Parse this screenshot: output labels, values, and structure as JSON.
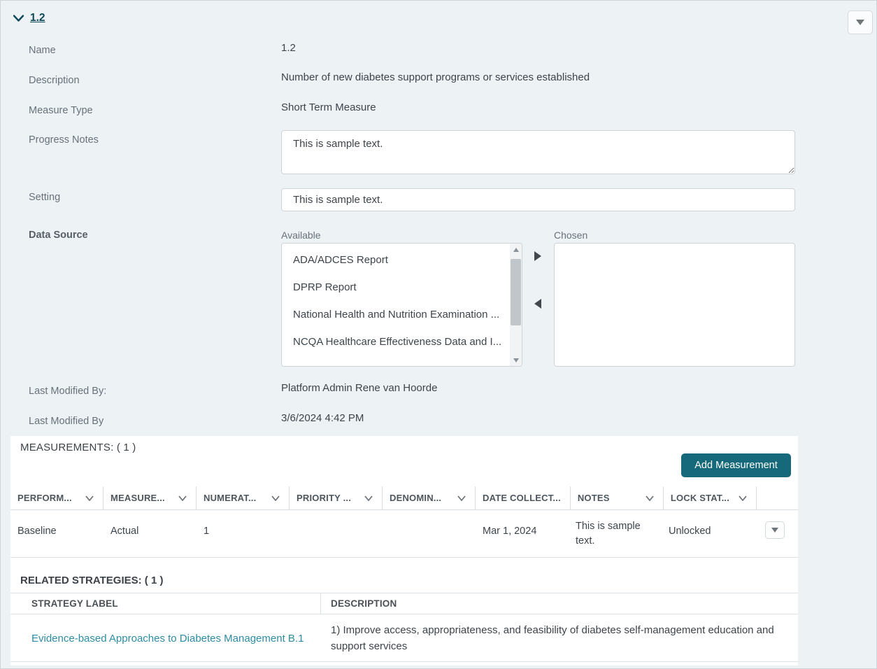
{
  "colors": {
    "background": "#edf2f5",
    "accent_teal": "#16697a",
    "dark_teal_link": "#0d4859",
    "strategy_link_teal": "#2e8ca2"
  },
  "header": {
    "title": "1.2",
    "collapse_icon": "chevron-down-icon",
    "menu_icon": "caret-down-icon"
  },
  "form": {
    "name": {
      "label": "Name",
      "value": "1.2"
    },
    "description": {
      "label": "Description",
      "value": "Number of new diabetes support programs or services established"
    },
    "measure_type": {
      "label": "Measure Type",
      "value": "Short Term Measure"
    },
    "progress_notes": {
      "label": "Progress Notes",
      "value": "This is sample text."
    },
    "setting": {
      "label": "Setting",
      "value": "This is sample text."
    },
    "data_source": {
      "label": "Data Source",
      "available_label": "Available",
      "chosen_label": "Chosen",
      "available_items": [
        "ADA/ADCES Report",
        "DPRP Report",
        "National Health and Nutrition Examination ...",
        "NCQA Healthcare Effectiveness Data and I..."
      ],
      "chosen_items": []
    },
    "last_modified_by_user": {
      "label": "Last Modified By:",
      "value": "Platform Admin Rene van Hoorde"
    },
    "last_modified_date": {
      "label": "Last Modified By",
      "value": "3/6/2024 4:42 PM"
    }
  },
  "measurements": {
    "title": "MEASUREMENTS: ( 1 )",
    "add_button_label": "Add Measurement",
    "columns": [
      {
        "label": "PERFORM...",
        "has_sort_icon": true
      },
      {
        "label": "MEASURE...",
        "has_sort_icon": true
      },
      {
        "label": "NUMERAT...",
        "has_sort_icon": true
      },
      {
        "label": "PRIORITY ...",
        "has_sort_icon": true
      },
      {
        "label": "DENOMIN...",
        "has_sort_icon": true
      },
      {
        "label": "DATE COLLECT...",
        "has_sort_icon": false
      },
      {
        "label": "NOTES",
        "has_sort_icon": true
      },
      {
        "label": "LOCK STAT...",
        "has_sort_icon": true
      }
    ],
    "rows": [
      {
        "performance": "Baseline",
        "measure": "Actual",
        "numerator": "1",
        "priority": "",
        "denominator": "",
        "date_collected": "Mar 1, 2024",
        "notes": "This is sample text.",
        "lock_status": "Unlocked"
      }
    ]
  },
  "related_strategies": {
    "title": "RELATED STRATEGIES: ( 1 )",
    "columns": {
      "label": "STRATEGY LABEL",
      "description": "DESCRIPTION"
    },
    "rows": [
      {
        "label": "Evidence-based Approaches to Diabetes Management B.1",
        "description": "1) Improve access, appropriateness, and feasibility of diabetes self-management education and support services"
      }
    ]
  }
}
